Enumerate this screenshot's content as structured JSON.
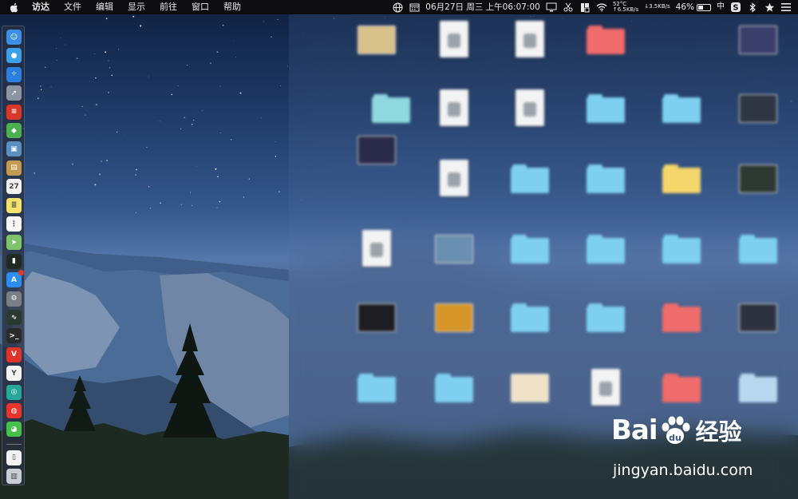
{
  "menubar": {
    "apple_icon": "apple-logo-icon",
    "app_name": "访达",
    "menus": [
      "文件",
      "编辑",
      "显示",
      "前往",
      "窗口",
      "帮助"
    ],
    "status": {
      "date_time": "06月27日 周三 上午06:07:00",
      "temperature": "52°C",
      "upload_speed": "↑6.5KB/s",
      "download_speed": "↓3.5KB/s",
      "battery_percent": "46%",
      "battery_level": 0.46,
      "input_method": "中",
      "icons": [
        "globe-icon",
        "calendar-icon",
        "display-icon",
        "scissors-icon",
        "script-icon",
        "wifi-icon",
        "network-stats-icon",
        "battery-icon",
        "ime-icon",
        "sogou-icon",
        "bluetooth-icon",
        "star-icon",
        "hamburger-menu-icon"
      ]
    }
  },
  "dock": {
    "items": [
      {
        "name": "finder",
        "color": "#3d8fe5",
        "glyph": "☺"
      },
      {
        "name": "siri",
        "color": "#3aa0e8",
        "glyph": "●"
      },
      {
        "name": "safari",
        "color": "#2a7fe0",
        "glyph": "✧"
      },
      {
        "name": "launchpad",
        "color": "#8c96a3",
        "glyph": "➚"
      },
      {
        "name": "wps",
        "color": "#d9372a",
        "glyph": "≡"
      },
      {
        "name": "android-studio",
        "color": "#4caf50",
        "glyph": "◆"
      },
      {
        "name": "preview",
        "color": "#5a8fc2",
        "glyph": "▣"
      },
      {
        "name": "notes-app",
        "color": "#c49a52",
        "glyph": "▤"
      },
      {
        "name": "calendar",
        "color": "#f2f2f2",
        "glyph": "27"
      },
      {
        "name": "notes",
        "color": "#f5e26a",
        "glyph": "≣"
      },
      {
        "name": "reminders",
        "color": "#f7f7f7",
        "glyph": "⋮"
      },
      {
        "name": "maps",
        "color": "#7cc36a",
        "glyph": "➤"
      },
      {
        "name": "terminal-dark",
        "color": "#1f2a22",
        "glyph": "▮"
      },
      {
        "name": "app-store",
        "color": "#2c8cf0",
        "glyph": "A",
        "badge": true
      },
      {
        "name": "system-preferences",
        "color": "#7a7f86",
        "glyph": "⚙"
      },
      {
        "name": "activity-monitor",
        "color": "#2b3a2e",
        "glyph": "∿"
      },
      {
        "name": "terminal",
        "color": "#2a2a2a",
        "glyph": ">_"
      },
      {
        "name": "vivaldi",
        "color": "#e0332c",
        "glyph": "V"
      },
      {
        "name": "yandex",
        "color": "#f4f4f4",
        "glyph": "Y"
      },
      {
        "name": "sourcetree",
        "color": "#25a89a",
        "glyph": "◎"
      },
      {
        "name": "weibo",
        "color": "#e5352c",
        "glyph": "◍"
      },
      {
        "name": "wechat",
        "color": "#45c14b",
        "glyph": "◕"
      },
      {
        "name": "documents",
        "color": "#f2f2f2",
        "glyph": "▯"
      },
      {
        "name": "trash",
        "color": "#c9ced4",
        "glyph": "▥"
      }
    ]
  },
  "desktop": {
    "items": [
      {
        "id": "item-1",
        "type": "photo",
        "color": "#d8c08a",
        "label": ""
      },
      {
        "id": "item-2",
        "type": "doc",
        "color": "#f3f3f3",
        "label": ""
      },
      {
        "id": "item-3",
        "type": "doc",
        "color": "#f3f3f3",
        "label": ""
      },
      {
        "id": "item-4",
        "type": "folder",
        "color": "#f06b6b",
        "label": ""
      },
      {
        "id": "item-5",
        "type": "photo",
        "color": "#3a3f6a",
        "label": ""
      },
      {
        "id": "item-6",
        "type": "folder",
        "color": "#8fd8e0",
        "label": ""
      },
      {
        "id": "item-7",
        "type": "doc",
        "color": "#f3f3f3",
        "label": ""
      },
      {
        "id": "item-8",
        "type": "doc",
        "color": "#f3f3f3",
        "label": ""
      },
      {
        "id": "item-9",
        "type": "folder",
        "color": "#7fd0f0",
        "label": ""
      },
      {
        "id": "item-10",
        "type": "folder",
        "color": "#7fd0f0",
        "label": ""
      },
      {
        "id": "item-11",
        "type": "photo",
        "color": "#2d3642",
        "label": ""
      },
      {
        "id": "item-12",
        "type": "photo",
        "color": "#2a2a4a",
        "label": ""
      },
      {
        "id": "item-13",
        "type": "doc",
        "color": "#f3f3f3",
        "label": ""
      },
      {
        "id": "item-14",
        "type": "folder",
        "color": "#7fd0f0",
        "label": ""
      },
      {
        "id": "item-15",
        "type": "folder",
        "color": "#7fd0f0",
        "label": ""
      },
      {
        "id": "item-16",
        "type": "folder",
        "color": "#f5d66b",
        "label": ""
      },
      {
        "id": "item-17",
        "type": "photo",
        "color": "#2d3a34",
        "label": ""
      },
      {
        "id": "item-18",
        "type": "doc",
        "color": "#f3f3f3",
        "label": ""
      },
      {
        "id": "item-19",
        "type": "photo",
        "color": "#6a8fb0",
        "label": ""
      },
      {
        "id": "item-20",
        "type": "folder",
        "color": "#7fd0f0",
        "label": ""
      },
      {
        "id": "item-21",
        "type": "folder",
        "color": "#7fd0f0",
        "label": ""
      },
      {
        "id": "item-22",
        "type": "folder",
        "color": "#7fd0f0",
        "label": ""
      },
      {
        "id": "item-23",
        "type": "folder",
        "color": "#7fd0f0",
        "label": ""
      },
      {
        "id": "item-24",
        "type": "photo",
        "color": "#1e1e22",
        "label": ""
      },
      {
        "id": "item-25",
        "type": "photo",
        "color": "#d7962a",
        "label": ""
      },
      {
        "id": "item-26",
        "type": "folder",
        "color": "#7fd0f0",
        "label": ""
      },
      {
        "id": "item-27",
        "type": "folder",
        "color": "#7fd0f0",
        "label": ""
      },
      {
        "id": "item-28",
        "type": "folder",
        "color": "#f06b6b",
        "label": ""
      },
      {
        "id": "item-29",
        "type": "photo",
        "color": "#2d3240",
        "label": ""
      },
      {
        "id": "item-30",
        "type": "folder",
        "color": "#7fd0f0",
        "label": ""
      },
      {
        "id": "item-31",
        "type": "folder",
        "color": "#7fd0f0",
        "label": ""
      },
      {
        "id": "item-32",
        "type": "photo",
        "color": "#efe2c8",
        "label": ""
      },
      {
        "id": "item-33",
        "type": "doc",
        "color": "#f3f3f3",
        "label": ""
      },
      {
        "id": "item-34",
        "type": "folder",
        "color": "#f06b6b",
        "label": ""
      },
      {
        "id": "item-35",
        "type": "folder",
        "color": "#b7d8ee",
        "label": ""
      }
    ]
  },
  "watermark": {
    "brand_left": "Bai",
    "brand_right": "du",
    "brand_cn": "经验",
    "url": "jingyan.baidu.com"
  }
}
